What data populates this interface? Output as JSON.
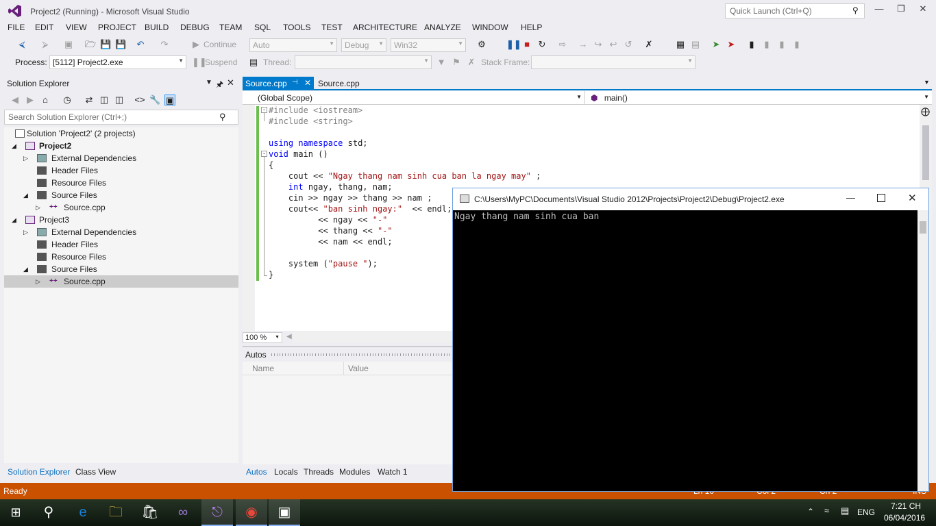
{
  "window": {
    "title": "Project2 (Running) - Microsoft Visual Studio",
    "quick_launch_placeholder": "Quick Launch (Ctrl+Q)"
  },
  "menu": [
    "FILE",
    "EDIT",
    "VIEW",
    "PROJECT",
    "BUILD",
    "DEBUG",
    "TEAM",
    "SQL",
    "TOOLS",
    "TEST",
    "ARCHITECTURE",
    "ANALYZE",
    "WINDOW",
    "HELP"
  ],
  "toolbar": {
    "continue_label": "Continue",
    "solution_config": "Auto",
    "build_config": "Debug",
    "platform": "Win32",
    "process_label": "Process:",
    "process_value": "[5112] Project2.exe",
    "suspend_label": "Suspend",
    "thread_label": "Thread:",
    "stack_frame_label": "Stack Frame:"
  },
  "solution_explorer": {
    "title": "Solution Explorer",
    "search_placeholder": "Search Solution Explorer (Ctrl+;)",
    "tree": [
      {
        "label": "Solution 'Project2' (2 projects)"
      },
      {
        "label": "Project2"
      },
      {
        "label": "External Dependencies"
      },
      {
        "label": "Header Files"
      },
      {
        "label": "Resource Files"
      },
      {
        "label": "Source Files"
      },
      {
        "label": "Source.cpp"
      },
      {
        "label": "Project3"
      },
      {
        "label": "External Dependencies"
      },
      {
        "label": "Header Files"
      },
      {
        "label": "Resource Files"
      },
      {
        "label": "Source Files"
      },
      {
        "label": "Source.cpp"
      }
    ],
    "tabs": [
      "Solution Explorer",
      "Class View"
    ]
  },
  "editor": {
    "tabs": [
      "Source.cpp",
      "Source.cpp"
    ],
    "scope": "(Global Scope)",
    "member": "main()",
    "zoom": "100 %",
    "code": [
      "#include <iostream>",
      "#include <string>",
      "",
      "using namespace std;",
      "void main ()",
      "{",
      "    cout << \"Ngay thang nam sinh cua ban la ngay may\" ;",
      "    int ngay, thang, nam;",
      "    cin >> ngay >> thang >> nam ;",
      "    cout<< \"ban sinh ngay:\"  << endl;",
      "          << ngay << \"-\"",
      "          << thang << \"-\"",
      "          << nam << endl;",
      "",
      "    system (\"pause \");",
      "}"
    ]
  },
  "autos": {
    "title": "Autos",
    "columns": [
      "Name",
      "Value"
    ],
    "tabs": [
      "Autos",
      "Locals",
      "Threads",
      "Modules",
      "Watch 1"
    ]
  },
  "status": {
    "text": "Ready",
    "ln": "Ln 10",
    "col": "Col 2",
    "ch": "Ch 2",
    "ins": "INS"
  },
  "console": {
    "title": "C:\\Users\\MyPC\\Documents\\Visual Studio 2012\\Projects\\Project2\\Debug\\Project2.exe",
    "output": "Ngay thang nam sinh cua ban"
  },
  "taskbar": {
    "lang": "ENG",
    "time": "7:21 CH",
    "date": "06/04/2016"
  }
}
